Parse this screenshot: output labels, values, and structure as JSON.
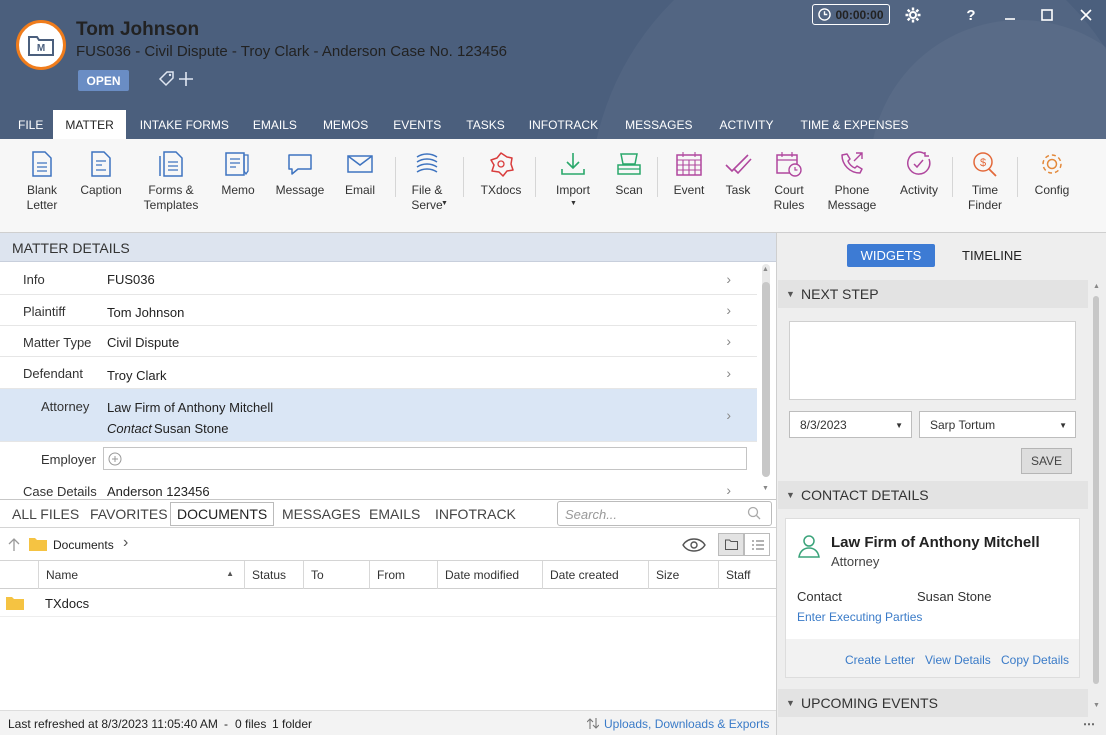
{
  "header": {
    "client_name": "Tom Johnson",
    "matter_description": "FUS036 - Civil Dispute - Troy Clark - Anderson Case No. 123456",
    "status": "OPEN",
    "timer": "00:00:00"
  },
  "window": {
    "help": "?"
  },
  "tabs": [
    "FILE",
    "MATTER",
    "INTAKE FORMS",
    "EMAILS",
    "MEMOS",
    "EVENTS",
    "TASKS",
    "INFOTRACK",
    "MESSAGES",
    "ACTIVITY",
    "TIME & EXPENSES"
  ],
  "active_tab": "MATTER",
  "ribbon": {
    "blank_letter": [
      "Blank",
      "Letter"
    ],
    "caption": "Caption",
    "forms": [
      "Forms &",
      "Templates"
    ],
    "memo": "Memo",
    "message": "Message",
    "email": "Email",
    "file_serve": [
      "File &",
      "Serve"
    ],
    "txdocs": "TXdocs",
    "import": "Import",
    "scan": "Scan",
    "event": "Event",
    "task": "Task",
    "court_rules": [
      "Court",
      "Rules"
    ],
    "phone_message": [
      "Phone",
      "Message"
    ],
    "activity": "Activity",
    "time_finder": [
      "Time",
      "Finder"
    ],
    "config": "Config"
  },
  "matter_details": {
    "title": "MATTER DETAILS",
    "info": {
      "label": "Info",
      "value": "FUS036"
    },
    "plaintiff": {
      "label": "Plaintiff",
      "value": "Tom Johnson"
    },
    "matter_type": {
      "label": "Matter Type",
      "value": "Civil Dispute"
    },
    "defendant": {
      "label": "Defendant",
      "value": "Troy Clark"
    },
    "attorney": {
      "label": "Attorney",
      "value": "Law Firm of Anthony Mitchell",
      "contact_label": "Contact",
      "contact_value": "Susan Stone"
    },
    "employer": {
      "label": "Employer"
    },
    "case_details": {
      "label": "Case Details",
      "value": "Anderson 123456"
    }
  },
  "doc_tabs": [
    "ALL FILES",
    "FAVORITES",
    "DOCUMENTS",
    "MESSAGES",
    "EMAILS",
    "INFOTRACK"
  ],
  "search_placeholder": "Search...",
  "breadcrumb": "Documents",
  "columns": [
    "Name",
    "Status",
    "To",
    "From",
    "Date modified",
    "Date created",
    "Size",
    "Staff"
  ],
  "files": [
    {
      "name": "TXdocs"
    }
  ],
  "statusbar": {
    "refreshed": "Last refreshed at 8/3/2023 11:05:40 AM",
    "files": "0 files",
    "folders": "1 folder",
    "uploads_link": "Uploads, Downloads & Exports"
  },
  "right_panel": {
    "widgets_label": "WIDGETS",
    "timeline_label": "TIMELINE",
    "next_step_title": "NEXT STEP",
    "date_value": "8/3/2023",
    "assignee_value": "Sarp Tortum",
    "save_label": "SAVE",
    "contact_details_title": "CONTACT DETAILS",
    "contact_name": "Law Firm of Anthony Mitchell",
    "contact_role": "Attorney",
    "contact_label": "Contact",
    "contact_value": "Susan Stone",
    "enter_parties": "Enter Executing Parties",
    "create_letter": "Create Letter",
    "view_details": "View Details",
    "copy_details": "Copy Details",
    "upcoming_events_title": "UPCOMING EVENTS"
  },
  "colors": {
    "header": "#4b5f7d",
    "accent": "#3d7bd4",
    "logo_ring": "#f07c1b",
    "link": "#3a7bc8"
  }
}
